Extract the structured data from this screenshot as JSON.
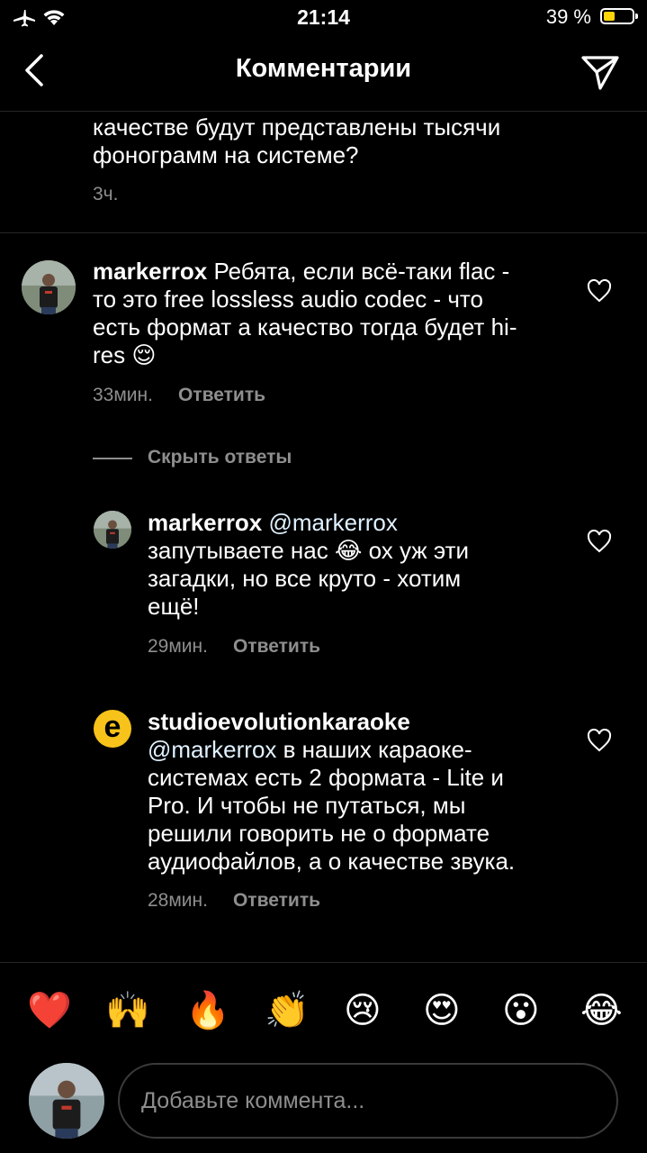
{
  "status_bar": {
    "time": "21:14",
    "battery_percent": "39 %",
    "battery_color": "#ffd60a"
  },
  "header": {
    "title": "Комментарии"
  },
  "prev_comment": {
    "lines": [
      "качестве будут представлены тысячи",
      "фонограмм на системе?"
    ],
    "time": "3ч."
  },
  "comments": [
    {
      "username": "markerrox",
      "lines": [
        "Ребята, если всё-таки flac -",
        "то это free lossless audio codec - что",
        "есть формат а качество тогда будет hi-",
        "res 😌"
      ],
      "time": "33мин.",
      "reply_label": "Ответить"
    }
  ],
  "hide_replies_label": "Скрыть ответы",
  "replies": [
    {
      "username": "markerrox",
      "mention": "@markerrox",
      "lines": [
        "запутываете нас 😂  ох уж эти",
        "загадки, но все круто - хотим",
        "ещё!"
      ],
      "time": "29мин.",
      "reply_label": "Ответить"
    },
    {
      "username": "studioevolutionkaraoke",
      "avatar_letter": "e",
      "mention": "@markerrox",
      "line1_rest": " в наших караоке-",
      "lines": [
        "системах есть 2 формата - Lite и",
        "Pro. И чтобы не путаться, мы",
        "решили говорить не о формате",
        "аудиофайлов, а о качестве звука."
      ],
      "time": "28мин.",
      "reply_label": "Ответить"
    }
  ],
  "reactions": [
    "❤️",
    "🙌",
    "🔥",
    "👏",
    "😢",
    "😍",
    "😮",
    "😂"
  ],
  "input": {
    "placeholder": "Добавьте коммента..."
  }
}
